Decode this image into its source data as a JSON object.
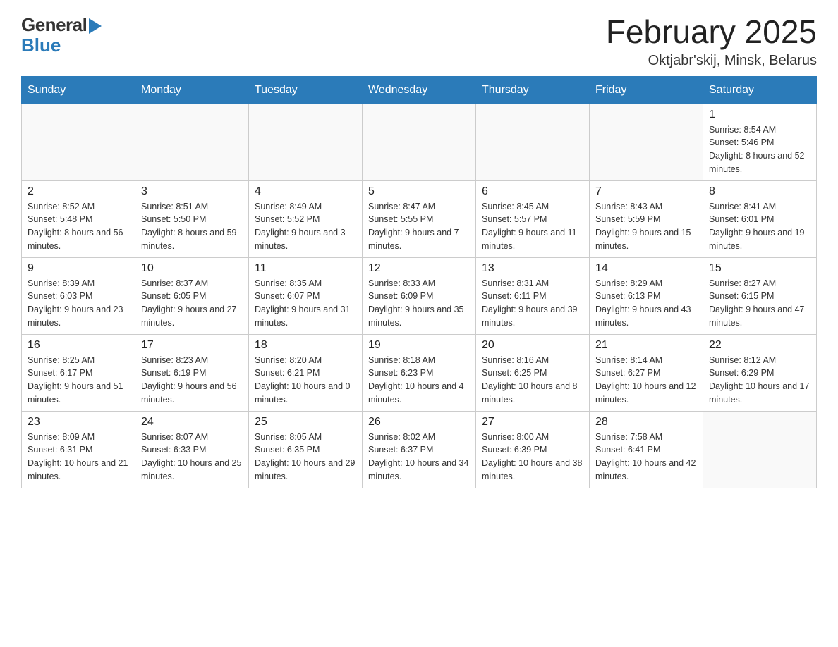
{
  "logo": {
    "text_general": "General",
    "text_blue": "Blue",
    "arrow": "▶"
  },
  "header": {
    "month_title": "February 2025",
    "location": "Oktjabr'skij, Minsk, Belarus"
  },
  "weekdays": [
    "Sunday",
    "Monday",
    "Tuesday",
    "Wednesday",
    "Thursday",
    "Friday",
    "Saturday"
  ],
  "weeks": [
    [
      {
        "day": "",
        "sunrise": "",
        "sunset": "",
        "daylight": ""
      },
      {
        "day": "",
        "sunrise": "",
        "sunset": "",
        "daylight": ""
      },
      {
        "day": "",
        "sunrise": "",
        "sunset": "",
        "daylight": ""
      },
      {
        "day": "",
        "sunrise": "",
        "sunset": "",
        "daylight": ""
      },
      {
        "day": "",
        "sunrise": "",
        "sunset": "",
        "daylight": ""
      },
      {
        "day": "",
        "sunrise": "",
        "sunset": "",
        "daylight": ""
      },
      {
        "day": "1",
        "sunrise": "Sunrise: 8:54 AM",
        "sunset": "Sunset: 5:46 PM",
        "daylight": "Daylight: 8 hours and 52 minutes."
      }
    ],
    [
      {
        "day": "2",
        "sunrise": "Sunrise: 8:52 AM",
        "sunset": "Sunset: 5:48 PM",
        "daylight": "Daylight: 8 hours and 56 minutes."
      },
      {
        "day": "3",
        "sunrise": "Sunrise: 8:51 AM",
        "sunset": "Sunset: 5:50 PM",
        "daylight": "Daylight: 8 hours and 59 minutes."
      },
      {
        "day": "4",
        "sunrise": "Sunrise: 8:49 AM",
        "sunset": "Sunset: 5:52 PM",
        "daylight": "Daylight: 9 hours and 3 minutes."
      },
      {
        "day": "5",
        "sunrise": "Sunrise: 8:47 AM",
        "sunset": "Sunset: 5:55 PM",
        "daylight": "Daylight: 9 hours and 7 minutes."
      },
      {
        "day": "6",
        "sunrise": "Sunrise: 8:45 AM",
        "sunset": "Sunset: 5:57 PM",
        "daylight": "Daylight: 9 hours and 11 minutes."
      },
      {
        "day": "7",
        "sunrise": "Sunrise: 8:43 AM",
        "sunset": "Sunset: 5:59 PM",
        "daylight": "Daylight: 9 hours and 15 minutes."
      },
      {
        "day": "8",
        "sunrise": "Sunrise: 8:41 AM",
        "sunset": "Sunset: 6:01 PM",
        "daylight": "Daylight: 9 hours and 19 minutes."
      }
    ],
    [
      {
        "day": "9",
        "sunrise": "Sunrise: 8:39 AM",
        "sunset": "Sunset: 6:03 PM",
        "daylight": "Daylight: 9 hours and 23 minutes."
      },
      {
        "day": "10",
        "sunrise": "Sunrise: 8:37 AM",
        "sunset": "Sunset: 6:05 PM",
        "daylight": "Daylight: 9 hours and 27 minutes."
      },
      {
        "day": "11",
        "sunrise": "Sunrise: 8:35 AM",
        "sunset": "Sunset: 6:07 PM",
        "daylight": "Daylight: 9 hours and 31 minutes."
      },
      {
        "day": "12",
        "sunrise": "Sunrise: 8:33 AM",
        "sunset": "Sunset: 6:09 PM",
        "daylight": "Daylight: 9 hours and 35 minutes."
      },
      {
        "day": "13",
        "sunrise": "Sunrise: 8:31 AM",
        "sunset": "Sunset: 6:11 PM",
        "daylight": "Daylight: 9 hours and 39 minutes."
      },
      {
        "day": "14",
        "sunrise": "Sunrise: 8:29 AM",
        "sunset": "Sunset: 6:13 PM",
        "daylight": "Daylight: 9 hours and 43 minutes."
      },
      {
        "day": "15",
        "sunrise": "Sunrise: 8:27 AM",
        "sunset": "Sunset: 6:15 PM",
        "daylight": "Daylight: 9 hours and 47 minutes."
      }
    ],
    [
      {
        "day": "16",
        "sunrise": "Sunrise: 8:25 AM",
        "sunset": "Sunset: 6:17 PM",
        "daylight": "Daylight: 9 hours and 51 minutes."
      },
      {
        "day": "17",
        "sunrise": "Sunrise: 8:23 AM",
        "sunset": "Sunset: 6:19 PM",
        "daylight": "Daylight: 9 hours and 56 minutes."
      },
      {
        "day": "18",
        "sunrise": "Sunrise: 8:20 AM",
        "sunset": "Sunset: 6:21 PM",
        "daylight": "Daylight: 10 hours and 0 minutes."
      },
      {
        "day": "19",
        "sunrise": "Sunrise: 8:18 AM",
        "sunset": "Sunset: 6:23 PM",
        "daylight": "Daylight: 10 hours and 4 minutes."
      },
      {
        "day": "20",
        "sunrise": "Sunrise: 8:16 AM",
        "sunset": "Sunset: 6:25 PM",
        "daylight": "Daylight: 10 hours and 8 minutes."
      },
      {
        "day": "21",
        "sunrise": "Sunrise: 8:14 AM",
        "sunset": "Sunset: 6:27 PM",
        "daylight": "Daylight: 10 hours and 12 minutes."
      },
      {
        "day": "22",
        "sunrise": "Sunrise: 8:12 AM",
        "sunset": "Sunset: 6:29 PM",
        "daylight": "Daylight: 10 hours and 17 minutes."
      }
    ],
    [
      {
        "day": "23",
        "sunrise": "Sunrise: 8:09 AM",
        "sunset": "Sunset: 6:31 PM",
        "daylight": "Daylight: 10 hours and 21 minutes."
      },
      {
        "day": "24",
        "sunrise": "Sunrise: 8:07 AM",
        "sunset": "Sunset: 6:33 PM",
        "daylight": "Daylight: 10 hours and 25 minutes."
      },
      {
        "day": "25",
        "sunrise": "Sunrise: 8:05 AM",
        "sunset": "Sunset: 6:35 PM",
        "daylight": "Daylight: 10 hours and 29 minutes."
      },
      {
        "day": "26",
        "sunrise": "Sunrise: 8:02 AM",
        "sunset": "Sunset: 6:37 PM",
        "daylight": "Daylight: 10 hours and 34 minutes."
      },
      {
        "day": "27",
        "sunrise": "Sunrise: 8:00 AM",
        "sunset": "Sunset: 6:39 PM",
        "daylight": "Daylight: 10 hours and 38 minutes."
      },
      {
        "day": "28",
        "sunrise": "Sunrise: 7:58 AM",
        "sunset": "Sunset: 6:41 PM",
        "daylight": "Daylight: 10 hours and 42 minutes."
      },
      {
        "day": "",
        "sunrise": "",
        "sunset": "",
        "daylight": ""
      }
    ]
  ]
}
